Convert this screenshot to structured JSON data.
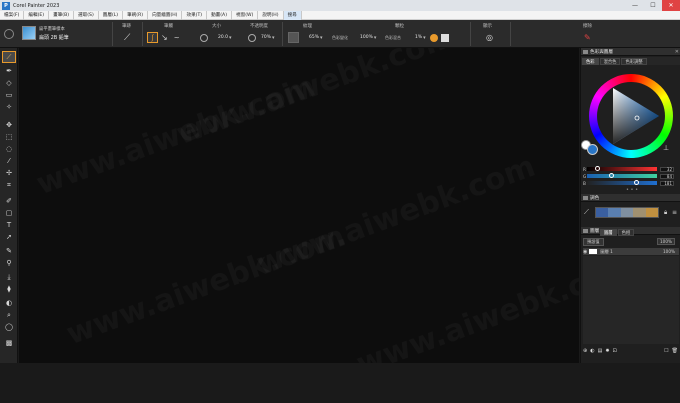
{
  "window": {
    "title": "Corel Painter 2023",
    "app_icon": "P",
    "minimize": "—",
    "maximize": "☐",
    "close": "✕"
  },
  "menu": [
    "檔案(F)",
    "編輯(E)",
    "畫筆(B)",
    "選取(S)",
    "圖層(L)",
    "筆刷(R)",
    "向量繪圖(H)",
    "效果(T)",
    "動畫(A)",
    "視窗(W)",
    "說明(H)",
    "搜尋"
  ],
  "propbar": {
    "brush_category": "扁平畫筆樣本",
    "brush_name": "扁頭 2B 鉛筆",
    "labels": {
      "stroke": "筆跡",
      "path": "筆觸",
      "size": "大小",
      "opacity": "不透明度",
      "texture": "紋理",
      "grain": "顆粒",
      "hide": "顯示",
      "clone": "擦除"
    },
    "size_value": "20.0",
    "opacity_value": "70%",
    "texture_value": "65%",
    "color_variability_label": "色彩變化",
    "color_variability_value": "100%",
    "color_mix_label": "色彩混合",
    "color_mix_value": "1%"
  },
  "right_panel": {
    "color_panel_title": "色彩與圖層",
    "color_tabs": [
      "色彩",
      "混合色",
      "色彩調整"
    ],
    "color_accent": "#2a76c6",
    "sliders": [
      {
        "label": "R",
        "value": "32",
        "fill": 0.12
      },
      {
        "label": "G",
        "value": "84",
        "fill": 0.33
      },
      {
        "label": "B",
        "value": "181",
        "fill": 0.71
      }
    ],
    "swatch_panel_title": "調色",
    "swatch_colors": [
      "#3a5fa0",
      "#5a7fb0",
      "#7f8fa0",
      "#a09070",
      "#c09040"
    ],
    "layers_panel_title": "圖層",
    "layers_tabs": [
      "圖層",
      "色相"
    ],
    "layer_blend": "預設值",
    "layer_opacity": "100%",
    "layers": [
      {
        "name": "圖層 1",
        "opacity": "100%"
      }
    ]
  },
  "canvas": {
    "watermark": "www.aiwebk.com"
  }
}
